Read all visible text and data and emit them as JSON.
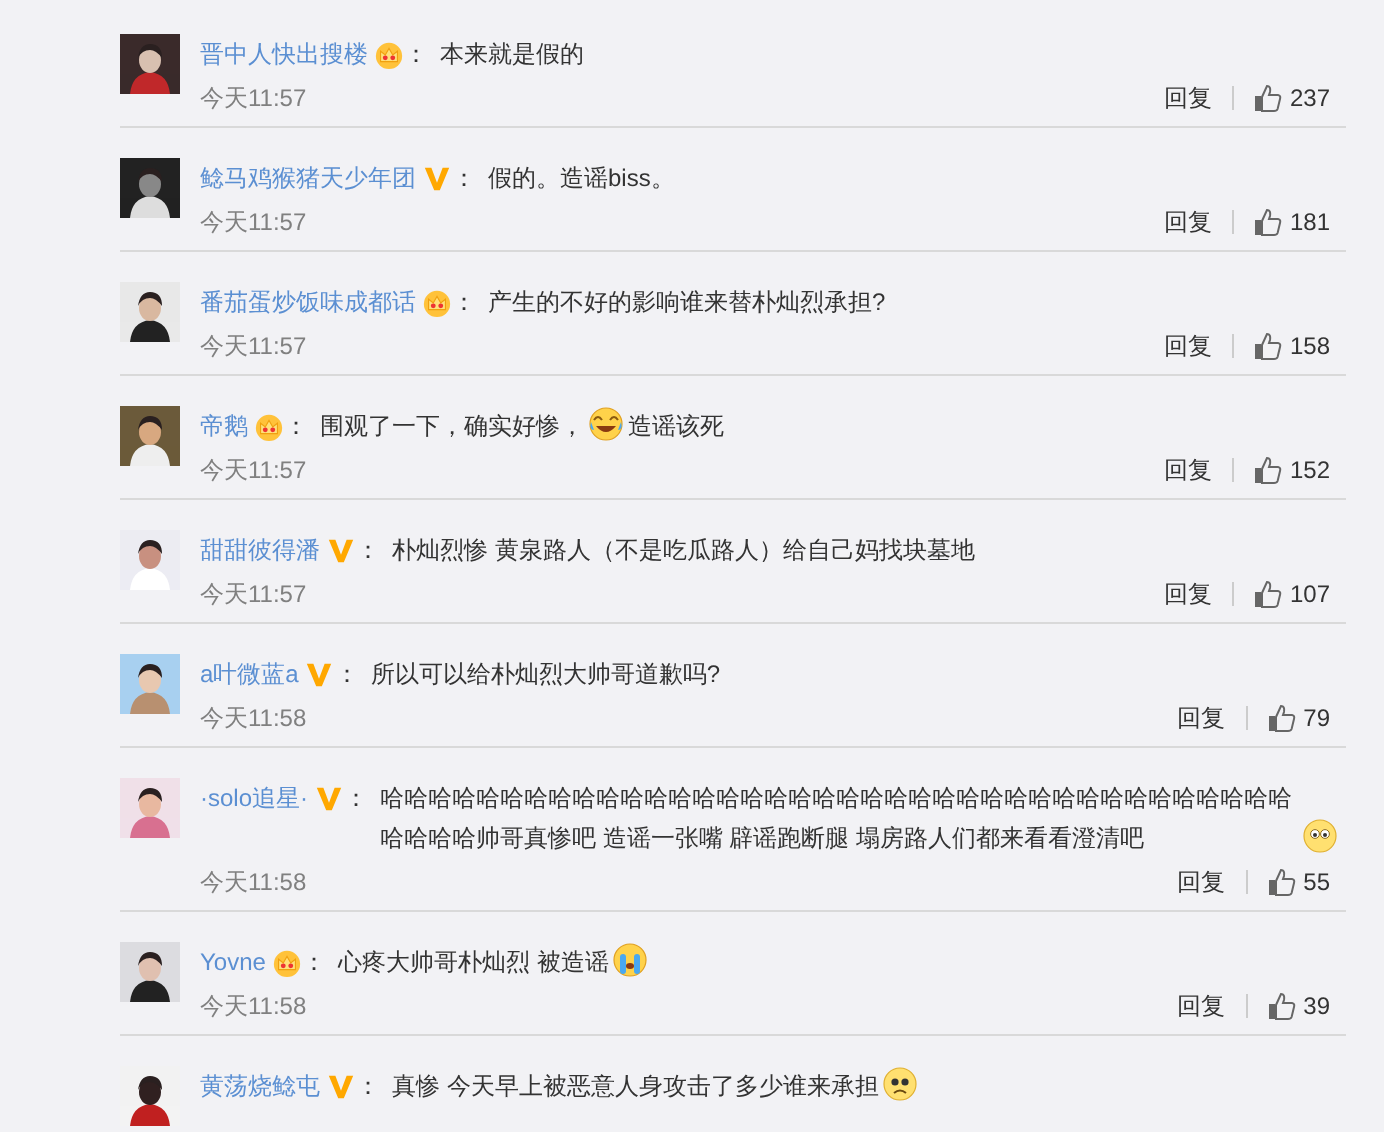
{
  "comments": [
    {
      "user": "晋中人快出搜楼",
      "badge": {
        "kind": "crown"
      },
      "colon": "：",
      "parts": [
        {
          "kind": "text",
          "text": "本来就是假的"
        }
      ],
      "time": "今天11:57",
      "reply": "回复",
      "likes": "237"
    },
    {
      "user": "鲶马鸡猴猪天少年团",
      "badge": {
        "kind": "v"
      },
      "colon": "：",
      "parts": [
        {
          "kind": "text",
          "text": "假的。造谣biss。"
        }
      ],
      "time": "今天11:57",
      "reply": "回复",
      "likes": "181"
    },
    {
      "user": "番茄蛋炒饭味成都话",
      "badge": {
        "kind": "crown"
      },
      "colon": "：",
      "parts": [
        {
          "kind": "text",
          "text": "产生的不好的影响谁来替朴灿烈承担?"
        }
      ],
      "time": "今天11:57",
      "reply": "回复",
      "likes": "158"
    },
    {
      "user": "帝鹅",
      "badge": {
        "kind": "crown"
      },
      "colon": "：",
      "parts": [
        {
          "kind": "text",
          "text": "围观了一下，确实好惨，"
        },
        {
          "kind": "emoji-laugh"
        },
        {
          "kind": "text",
          "text": "造谣该死"
        }
      ],
      "time": "今天11:57",
      "reply": "回复",
      "likes": "152"
    },
    {
      "user": "甜甜彼得潘",
      "badge": {
        "kind": "v"
      },
      "colon": "：",
      "parts": [
        {
          "kind": "text",
          "text": "朴灿烈惨 黄泉路人（不是吃瓜路人）给自己妈找块墓地"
        }
      ],
      "time": "今天11:57",
      "reply": "回复",
      "likes": "107"
    },
    {
      "user": "a叶微蓝a",
      "badge": {
        "kind": "v"
      },
      "colon": "：",
      "parts": [
        {
          "kind": "text",
          "text": "所以可以给朴灿烈大帅哥道歉吗?"
        }
      ],
      "time": "今天11:58",
      "reply": "回复",
      "likes": "79"
    },
    {
      "user": "·solo追星·",
      "badge": {
        "kind": "v"
      },
      "colon": "：",
      "parts": [
        {
          "kind": "text",
          "text": "哈哈哈哈哈哈哈哈哈哈哈哈哈哈哈哈哈哈哈哈哈哈哈哈哈哈哈哈哈哈哈哈哈哈哈哈哈哈哈哈哈哈帅哥真惨吧 造谣一张嘴 辟谣跑断腿 塌房路人们都来看看澄清吧"
        },
        {
          "kind": "emoji-stare"
        }
      ],
      "time": "今天11:58",
      "reply": "回复",
      "likes": "55"
    },
    {
      "user": "Yovne",
      "badge": {
        "kind": "crown"
      },
      "colon": "：",
      "parts": [
        {
          "kind": "text",
          "text": "心疼大帅哥朴灿烈 被造谣"
        },
        {
          "kind": "emoji-cry"
        }
      ],
      "time": "今天11:58",
      "reply": "回复",
      "likes": "39"
    },
    {
      "user": "黄荡烧鲶屯",
      "badge": {
        "kind": "v"
      },
      "colon": "：",
      "parts": [
        {
          "kind": "text",
          "text": "真惨 今天早上被恶意人身攻击了多少谁来承担"
        },
        {
          "kind": "emoji-sad"
        }
      ]
    }
  ]
}
